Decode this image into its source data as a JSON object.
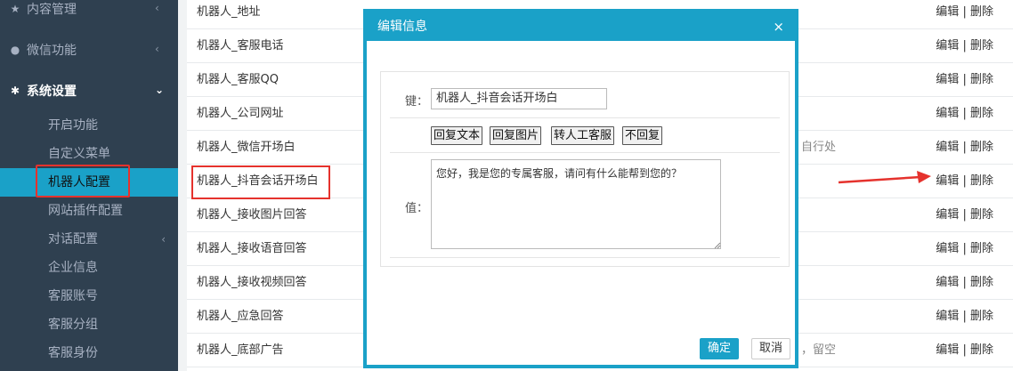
{
  "sidebar": {
    "groups": [
      {
        "label": "内容管理",
        "icon": "star-icon"
      },
      {
        "label": "微信功能",
        "icon": "wechat-icon"
      },
      {
        "label": "系统设置",
        "icon": "gear-icon"
      }
    ],
    "items": [
      {
        "label": "开启功能"
      },
      {
        "label": "自定义菜单"
      },
      {
        "label": "机器人配置"
      },
      {
        "label": "网站插件配置"
      },
      {
        "label": "对话配置"
      },
      {
        "label": "企业信息"
      },
      {
        "label": "客服账号"
      },
      {
        "label": "客服分组"
      },
      {
        "label": "客服身份"
      }
    ]
  },
  "list": {
    "edit_label": "编辑",
    "separator": "|",
    "delete_label": "删除",
    "rows": [
      {
        "key": "机器人_地址"
      },
      {
        "key": "机器人_客服电话"
      },
      {
        "key": "机器人_客服QQ"
      },
      {
        "key": "机器人_公司网址"
      },
      {
        "key": "机器人_微信开场白",
        "peek": "自行处"
      },
      {
        "key": "机器人_抖音会话开场白"
      },
      {
        "key": "机器人_接收图片回答"
      },
      {
        "key": "机器人_接收语音回答"
      },
      {
        "key": "机器人_接收视频回答"
      },
      {
        "key": "机器人_应急回答"
      },
      {
        "key": "机器人_底部广告",
        "peek": "，留空"
      }
    ]
  },
  "modal": {
    "title": "编辑信息",
    "close": "×",
    "key_label": "键：",
    "key_value": "机器人_抖音会话开场白",
    "quick_buttons": [
      "回复文本",
      "回复图片",
      "转人工客服",
      "不回复"
    ],
    "value_label": "值：",
    "value_text": "您好，我是您的专属客服，请问有什么能帮到您的？",
    "ok_label": "确定",
    "cancel_label": "取消"
  },
  "colors": {
    "sidebar_bg": "#2f4050",
    "accent": "#1aa1c8",
    "highlight_red": "#e5322d"
  }
}
